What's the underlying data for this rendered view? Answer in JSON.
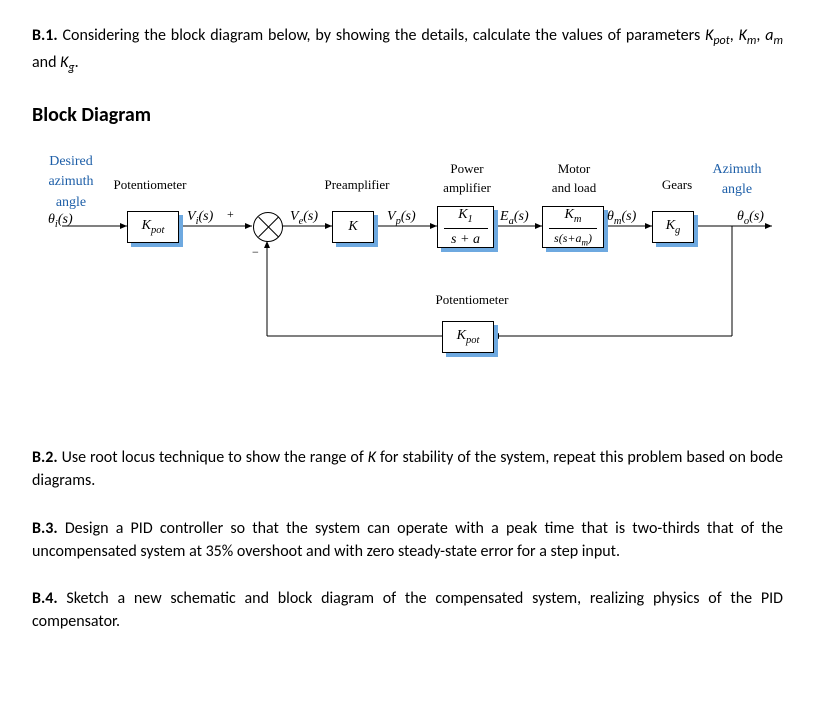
{
  "b1": {
    "num": "B.1.",
    "text": "Considering the block diagram below, by showing the details, calculate the values of parameters K_pot, K_m, a_m and K_g.",
    "text_html": "Considering the block diagram below, by showing the details, calculate the values of parameters <i>K<sub>pot</sub></i>, <i>K<sub>m</sub></i>, <i>a<sub>m</sub></i> and <i>K<sub>g</sub></i>."
  },
  "diagram": {
    "title": "Block Diagram",
    "blocks": {
      "pot_in": {
        "top_label": "Potentiometer",
        "content_top": "K_pot"
      },
      "preamp": {
        "top_label": "Preamplifier",
        "content_top": "K"
      },
      "poweramp": {
        "top_label": "Power amplifier",
        "num": "K_1",
        "den": "s + a"
      },
      "motor": {
        "top_label": "Motor and load",
        "num": "K_m",
        "den": "s(s+a_m)"
      },
      "gears": {
        "top_label": "Gears",
        "content_top": "K_g"
      },
      "pot_fb": {
        "top_label": "Potentiometer",
        "content_top": "K_pot"
      }
    },
    "signals": {
      "theta_i": "θ_i(s)",
      "theta_i_label": "Desired azimuth angle",
      "v_i": "V_i(s)",
      "v_e": "V_e(s)",
      "v_p": "V_p(s)",
      "e_a": "E_a(s)",
      "theta_m": "θ_m(s)",
      "theta_o": "θ_o(s)",
      "theta_o_label": "Azimuth angle"
    },
    "sum": {
      "plus": "+",
      "minus": "−"
    }
  },
  "b2": {
    "num": "B.2.",
    "text_html": "Use root locus technique to show the range of <i>K</i> for stability of the system, repeat this problem based on bode diagrams."
  },
  "b3": {
    "num": "B.3.",
    "text_html": "Design a PID controller so that the system can operate with a peak time that is two-thirds that of the uncompensated system at 35% overshoot and with zero steady-state error for a step input."
  },
  "b4": {
    "num": "B.4.",
    "text_html": "Sketch a new schematic and block diagram of the compensated system, realizing physics of the PID compensator."
  }
}
